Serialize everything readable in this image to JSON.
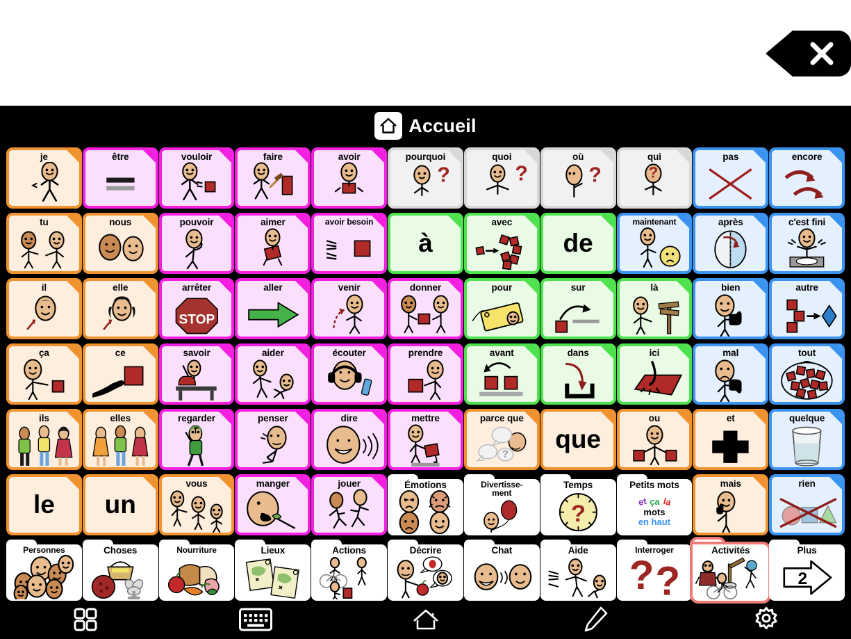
{
  "window": {
    "close_label": "×",
    "background": "#ffffff"
  },
  "header": {
    "home_icon": "home-icon",
    "title": "Accueil"
  },
  "palette": {
    "pronoun_border": "#f0922f",
    "pronoun_fill": "#fdeede",
    "verb_border": "#f41fe0",
    "verb_fill": "#fae0fd",
    "question_border": "#d8d8d8",
    "question_fill": "#f1f1f1",
    "prep_border": "#4fe24f",
    "prep_fill": "#e9fbe5",
    "descr_border": "#3b93f0",
    "descr_fill": "#e4f0fd",
    "conj_border": "#f0922f",
    "conj_fill": "#fdeede",
    "folder_fill": "#ffffff",
    "selected_outline": "#ef7b76",
    "board_background": "#000000",
    "label_color": "#000000",
    "title_color": "#ffffff"
  },
  "grid": {
    "columns": 11,
    "rows": 7,
    "cells": [
      {
        "label": "je",
        "style": "pronoun",
        "art": "person-pointing-self"
      },
      {
        "label": "être",
        "style": "verb",
        "art": "equals-bars"
      },
      {
        "label": "vouloir",
        "style": "verb",
        "art": "person-reaching-block"
      },
      {
        "label": "faire",
        "style": "verb",
        "art": "person-hammer-block"
      },
      {
        "label": "avoir",
        "style": "verb",
        "art": "person-holding-block"
      },
      {
        "label": "pourquoi",
        "style": "question",
        "art": "person-thinking-question"
      },
      {
        "label": "quoi",
        "style": "question",
        "art": "person-shrug-question"
      },
      {
        "label": "où",
        "style": "question",
        "art": "person-looking-question"
      },
      {
        "label": "qui",
        "style": "question",
        "art": "person-question-face"
      },
      {
        "label": "pas",
        "style": "descr",
        "art": "red-x"
      },
      {
        "label": "encore",
        "style": "descr",
        "art": "two-curved-arrows"
      },
      {
        "label": "tu",
        "style": "pronoun",
        "art": "two-people-pointing"
      },
      {
        "label": "nous",
        "style": "pronoun",
        "art": "two-faces"
      },
      {
        "label": "pouvoir",
        "style": "verb",
        "art": "person-flexing"
      },
      {
        "label": "aimer",
        "style": "verb",
        "art": "person-hugging-heart-block"
      },
      {
        "label": "avoir besoin",
        "style": "verb",
        "art": "hands-reaching-block",
        "small_label": true
      },
      {
        "label": "à",
        "style": "prep",
        "art": "",
        "word": true
      },
      {
        "label": "avec",
        "style": "prep",
        "art": "blocks-joining"
      },
      {
        "label": "de",
        "style": "prep",
        "art": "",
        "word": true
      },
      {
        "label": "maintenant",
        "style": "descr",
        "art": "person-pointing-clock",
        "small_label": true
      },
      {
        "label": "après",
        "style": "descr",
        "art": "half-circle-arrow"
      },
      {
        "label": "c'est fini",
        "style": "descr",
        "art": "person-empty-plate"
      },
      {
        "label": "il",
        "style": "pronoun",
        "art": "boy-face-arrow"
      },
      {
        "label": "elle",
        "style": "pronoun",
        "art": "girl-face-arrow"
      },
      {
        "label": "arrêter",
        "style": "verb",
        "art": "stop-sign"
      },
      {
        "label": "aller",
        "style": "verb",
        "art": "green-arrow"
      },
      {
        "label": "venir",
        "style": "verb",
        "art": "person-coming-arrow"
      },
      {
        "label": "donner",
        "style": "verb",
        "art": "two-people-giving-block"
      },
      {
        "label": "pour",
        "style": "prep",
        "art": "gift-tag"
      },
      {
        "label": "sur",
        "style": "prep",
        "art": "block-over-line"
      },
      {
        "label": "là",
        "style": "prep",
        "art": "person-pointing-signpost"
      },
      {
        "label": "bien",
        "style": "descr",
        "art": "person-thumbs-up"
      },
      {
        "label": "autre",
        "style": "descr",
        "art": "blocks-to-diamond"
      },
      {
        "label": "ça",
        "style": "pronoun",
        "art": "person-pointing-block"
      },
      {
        "label": "ce",
        "style": "pronoun",
        "art": "hand-pointing-block"
      },
      {
        "label": "savoir",
        "style": "verb",
        "art": "person-raising-hand-desk"
      },
      {
        "label": "aider",
        "style": "verb",
        "art": "person-helping-person"
      },
      {
        "label": "écouter",
        "style": "verb",
        "art": "person-headphones"
      },
      {
        "label": "prendre",
        "style": "verb",
        "art": "person-taking-block"
      },
      {
        "label": "avant",
        "style": "prep",
        "art": "two-blocks-back-arrow"
      },
      {
        "label": "dans",
        "style": "prep",
        "art": "arrow-into-container"
      },
      {
        "label": "ici",
        "style": "prep",
        "art": "hand-tapping-surface"
      },
      {
        "label": "mal",
        "style": "descr",
        "art": "person-thumbs-down"
      },
      {
        "label": "tout",
        "style": "descr",
        "art": "many-blocks-circled"
      },
      {
        "label": "ils",
        "style": "pronoun",
        "art": "three-people-mixed"
      },
      {
        "label": "elles",
        "style": "pronoun",
        "art": "three-women"
      },
      {
        "label": "regarder",
        "style": "verb",
        "art": "person-walking-looking"
      },
      {
        "label": "penser",
        "style": "verb",
        "art": "person-thinking"
      },
      {
        "label": "dire",
        "style": "verb",
        "art": "face-speaking"
      },
      {
        "label": "mettre",
        "style": "verb",
        "art": "person-placing-block"
      },
      {
        "label": "parce que",
        "style": "conj",
        "art": "speech-bubbles-question"
      },
      {
        "label": "que",
        "style": "conj",
        "art": "",
        "word": true
      },
      {
        "label": "ou",
        "style": "conj",
        "art": "person-two-blocks"
      },
      {
        "label": "et",
        "style": "conj",
        "art": "black-plus"
      },
      {
        "label": "quelque",
        "style": "descr",
        "art": "glass-half-water"
      },
      {
        "label": "le",
        "style": "pronoun",
        "art": "",
        "word": true
      },
      {
        "label": "un",
        "style": "pronoun",
        "art": "",
        "word": true
      },
      {
        "label": "vous",
        "style": "pronoun",
        "art": "person-pointing-group"
      },
      {
        "label": "manger",
        "style": "verb",
        "art": "face-eating-fork"
      },
      {
        "label": "jouer",
        "style": "verb",
        "art": "two-people-running"
      },
      {
        "label": "Émotions",
        "style": "folder",
        "art": "four-emotion-faces"
      },
      {
        "label": "Divertisse-\nment",
        "style": "folder",
        "art": "face-balloon",
        "small_label": true
      },
      {
        "label": "Temps",
        "style": "folder",
        "art": "clock-question"
      },
      {
        "label": "Petits mots",
        "style": "folder",
        "art": "small-words-text"
      },
      {
        "label": "mais",
        "style": "conj",
        "art": "person-pointing-up"
      },
      {
        "label": "rien",
        "style": "descr",
        "art": "shapes-crossed-out"
      },
      {
        "label": "Personnes",
        "style": "folder",
        "art": "group-of-faces",
        "small_label": true
      },
      {
        "label": "Choses",
        "style": "folder",
        "art": "ball-basket-fan"
      },
      {
        "label": "Nourriture",
        "style": "folder",
        "art": "bread-apple-carrot",
        "small_label": true
      },
      {
        "label": "Lieux",
        "style": "folder",
        "art": "two-maps"
      },
      {
        "label": "Actions",
        "style": "folder",
        "art": "bike-walk-figures"
      },
      {
        "label": "Décrire",
        "style": "folder",
        "art": "person-describing-apple"
      },
      {
        "label": "Chat",
        "style": "folder",
        "art": "two-faces-talking"
      },
      {
        "label": "Aide",
        "style": "folder",
        "art": "hands-helping-person"
      },
      {
        "label": "Interroger",
        "style": "folder",
        "art": "two-question-marks",
        "small_label": true
      },
      {
        "label": "Activités",
        "style": "folder",
        "art": "activities-figures",
        "selected": true
      },
      {
        "label": "Plus",
        "style": "folder",
        "art": "arrow-page-2",
        "page_number": "2"
      }
    ]
  },
  "small_words_tile": {
    "line1": "Petits mots",
    "word_et": "et",
    "word_ca": "ça",
    "word_la": "la",
    "line3": "mots",
    "line4": "en haut",
    "color_et": "#7b2fbf",
    "color_ca": "#2fa84f",
    "color_la": "#d62828",
    "color_en_haut": "#3b93f0"
  },
  "toolbar": {
    "items": [
      {
        "name": "grid-view-icon",
        "label": "Vue grille"
      },
      {
        "name": "keyboard-icon",
        "label": "Clavier"
      },
      {
        "name": "home-icon",
        "label": "Accueil"
      },
      {
        "name": "edit-pencil-icon",
        "label": "Modifier"
      },
      {
        "name": "settings-gear-icon",
        "label": "Réglages"
      }
    ]
  }
}
